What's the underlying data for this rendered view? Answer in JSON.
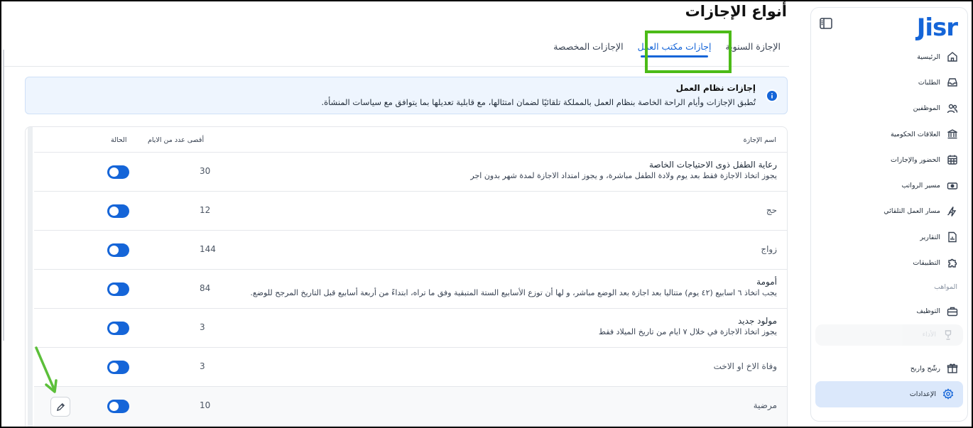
{
  "page": {
    "title": "أنواع الإجازات"
  },
  "tabs": [
    {
      "label": "الإجازة السنوية"
    },
    {
      "label": "إجازات مكتب العمل"
    },
    {
      "label": "الإجازات المخصصة"
    }
  ],
  "active_tab": "إجازات مكتب العمل",
  "info": {
    "title": "إجازات نظام العمل",
    "description": "تُطبق الإجازات وأيام الراحة الخاصة بنظام العمل بالمملكة تلقائيًا لضمان امتثالها، مع قابلية تعديلها بما يتوافق مع سياسات المنشأة."
  },
  "table": {
    "headers": {
      "name": "اسم الإجازة",
      "max_days": "أقصى عدد من الايام",
      "status": "الحالة"
    },
    "rows": [
      {
        "title": "رعاية الطفل ذوى الاحتياجات الخاصة",
        "desc": "يجوز اتخاذ الاجازة فقط بعد يوم ولادة الطفل مباشرة، و يجوز امتداد الاجازة لمدة شهر بدون اجر",
        "max": "30",
        "enabled": true
      },
      {
        "title": "حج",
        "desc": "",
        "max": "12",
        "enabled": true
      },
      {
        "title": "زواج",
        "desc": "",
        "max": "144",
        "enabled": true
      },
      {
        "title": "أمومة",
        "desc": "يجب اتخاذ ٦ اسابيع (٤٢ يوم) متتاليا بعد اجازة بعد الوضع مباشر، و لها أن توزع الأسابيع الستة المتبقية وفق ما تراه، ابتداءً من أربعة أسابيع قبل التاريخ المرجح للوضع.",
        "max": "84",
        "enabled": true
      },
      {
        "title": "مولود جديد",
        "desc": "يجوز اتخاذ الاجازة في خلال ٧ ايام من تاريخ الميلاد فقط",
        "max": "3",
        "enabled": true
      },
      {
        "title": "وفاة الاخ او الاخت",
        "desc": "",
        "max": "3",
        "enabled": true
      },
      {
        "title": "مرضية",
        "desc": "",
        "max": "10",
        "enabled": true
      }
    ]
  },
  "sidebar": {
    "logo": "Jisr",
    "items": [
      {
        "label": "الرئيسية",
        "icon": "home-icon"
      },
      {
        "label": "الطلبات",
        "icon": "inbox-icon"
      },
      {
        "label": "الموظفين",
        "icon": "users-icon"
      },
      {
        "label": "العلاقات الحكومية",
        "icon": "government-icon"
      },
      {
        "label": "الحضور والإجازات",
        "icon": "calendar-icon"
      },
      {
        "label": "مسير الرواتب",
        "icon": "money-icon"
      },
      {
        "label": "مسار العمل التلقائي",
        "icon": "automation-icon"
      },
      {
        "label": "التقارير",
        "icon": "report-icon"
      },
      {
        "label": "التطبيقات",
        "icon": "puzzle-icon"
      }
    ],
    "section_label": "المواهب",
    "talent_items": [
      {
        "label": "التوظيف",
        "icon": "briefcase-icon"
      },
      {
        "label": "الأداء",
        "icon": "trophy-icon"
      }
    ],
    "bottom_items": [
      {
        "label": "رشّح واربح",
        "icon": "gift-icon"
      },
      {
        "label": "الإعدادات",
        "icon": "gear-icon"
      }
    ]
  },
  "colors": {
    "accent": "#1565d8",
    "highlight": "#4cbb17",
    "info_bg": "#eef5fe",
    "active_nav_bg": "#dbe8fb"
  }
}
